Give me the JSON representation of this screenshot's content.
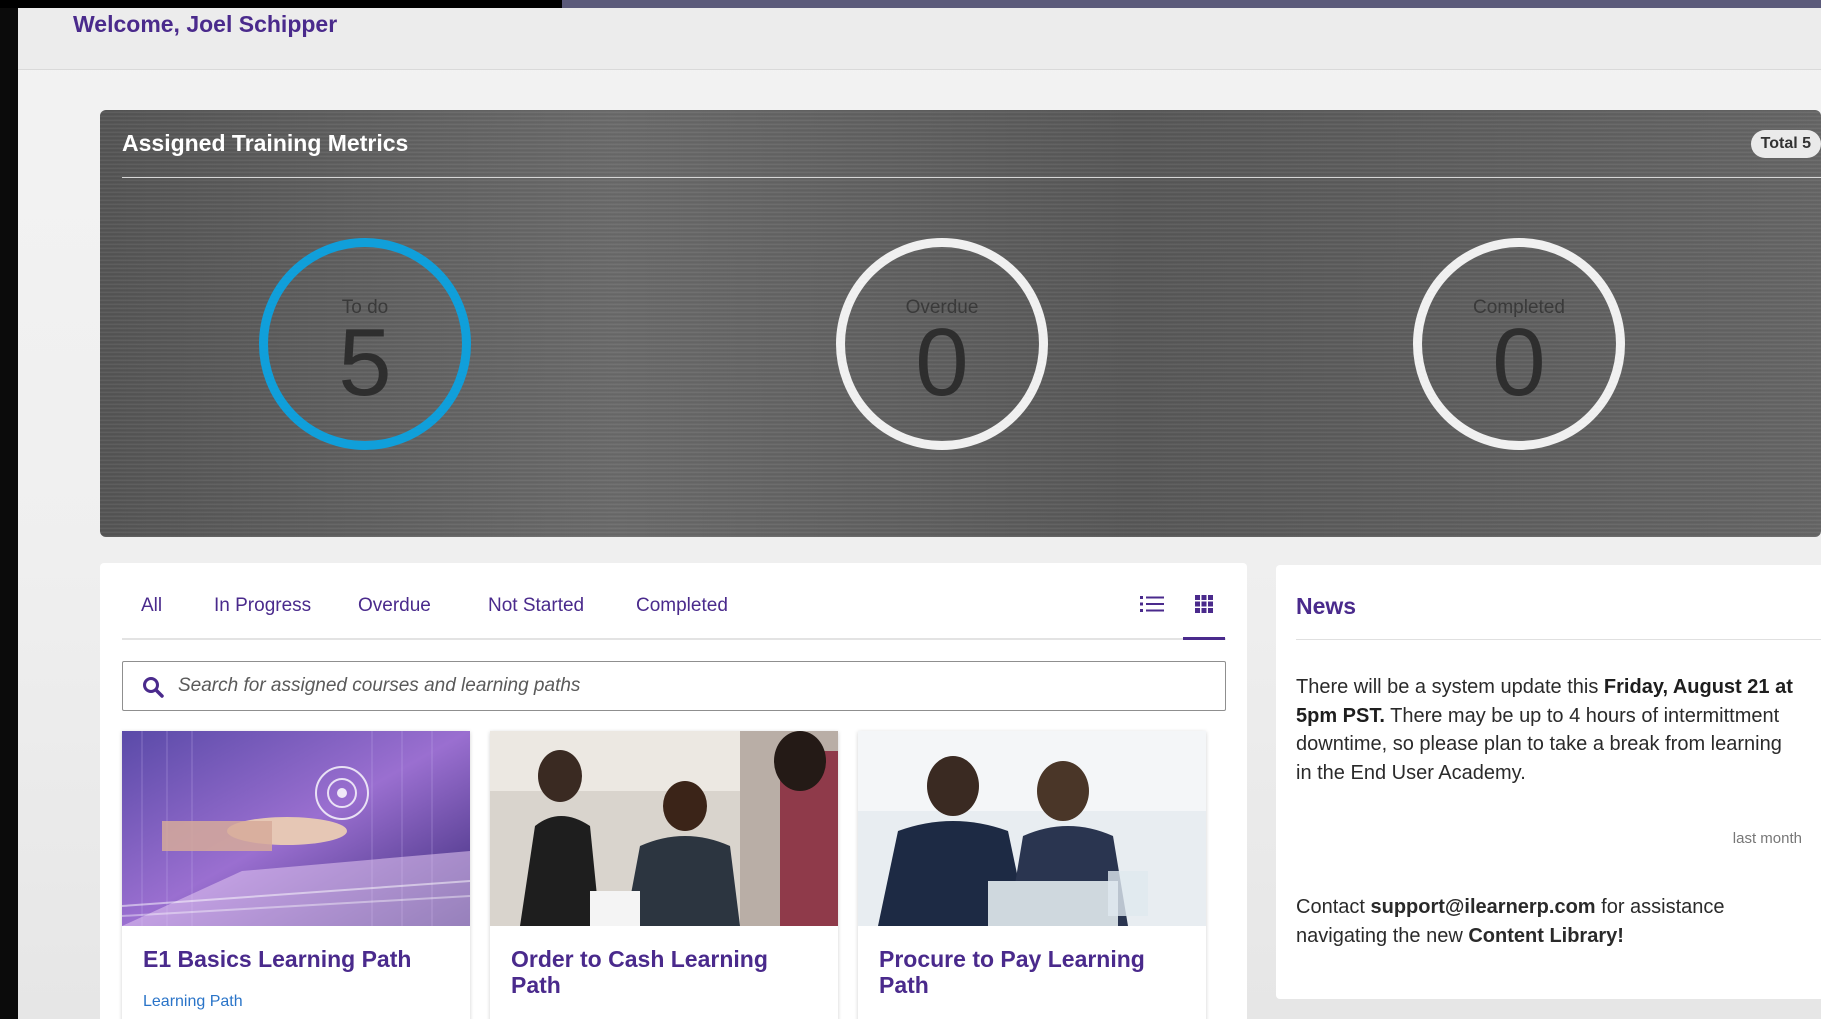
{
  "header": {
    "welcome": "Welcome, Joel Schipper"
  },
  "metrics": {
    "title": "Assigned Training Metrics",
    "total_label": "Total 5",
    "items": [
      {
        "label": "To do",
        "value": "5",
        "color": "#109fda"
      },
      {
        "label": "Overdue",
        "value": "0",
        "color": "#f0f0f0"
      },
      {
        "label": "Completed",
        "value": "0",
        "color": "#f0f0f0"
      }
    ]
  },
  "courses": {
    "tabs": [
      "All",
      "In Progress",
      "Overdue",
      "Not Started",
      "Completed"
    ],
    "view_buttons": [
      "list-view-icon",
      "grid-view-icon"
    ],
    "active_view": "grid",
    "search_placeholder": "Search for assigned courses and learning paths",
    "cards": [
      {
        "title": "E1 Basics Learning Path",
        "type": "Learning Path"
      },
      {
        "title": "Order to Cash Learning Path",
        "type": ""
      },
      {
        "title": "Procure to Pay Learning Path",
        "type": ""
      }
    ]
  },
  "news": {
    "title": "News",
    "items": [
      {
        "text_1": "There will be a system update this ",
        "bold_1": "Friday, August 21 at 5pm PST.",
        "text_2": " There may be up to 4 hours of intermittment downtime, so please plan to take a break from learning in the End User Academy.",
        "time": "last month"
      },
      {
        "text_1": "Contact ",
        "bold_1": "support@ilearnerp.com",
        "text_2": " for assistance navigating the new ",
        "bold_2": "Content Library!"
      }
    ]
  },
  "colors": {
    "brand_purple": "#4a2a8c",
    "accent_blue": "#109fda",
    "link_blue": "#2a74c8"
  }
}
